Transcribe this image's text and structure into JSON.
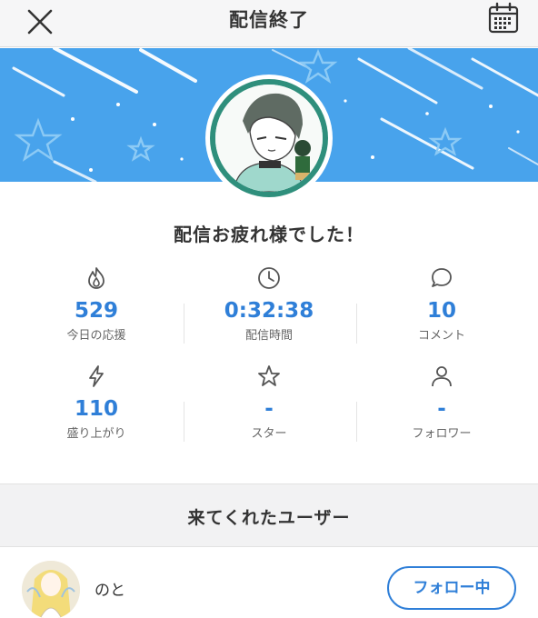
{
  "header": {
    "title": "配信終了",
    "close_icon": "close-icon",
    "calendar_icon": "calendar-icon"
  },
  "banner": {
    "color": "#48a3ec",
    "ring_color": "#2f8f7c"
  },
  "message": "配信お疲れ様でした！",
  "stats": [
    {
      "icon": "flame-icon",
      "value": "529",
      "label": "今日の応援"
    },
    {
      "icon": "clock-icon",
      "value": "0:32:38",
      "label": "配信時間"
    },
    {
      "icon": "comment-icon",
      "value": "10",
      "label": "コメント"
    },
    {
      "icon": "lightning-icon",
      "value": "110",
      "label": "盛り上がり"
    },
    {
      "icon": "star-icon",
      "value": "-",
      "label": "スター"
    },
    {
      "icon": "person-icon",
      "value": "-",
      "label": "フォロワー"
    }
  ],
  "visitors": {
    "title": "来てくれたユーザー",
    "users": [
      {
        "name": "のと",
        "follow_label": "フォロー中"
      }
    ]
  },
  "colors": {
    "accent": "#2f7fd8",
    "text": "#333333",
    "muted": "#666666"
  }
}
